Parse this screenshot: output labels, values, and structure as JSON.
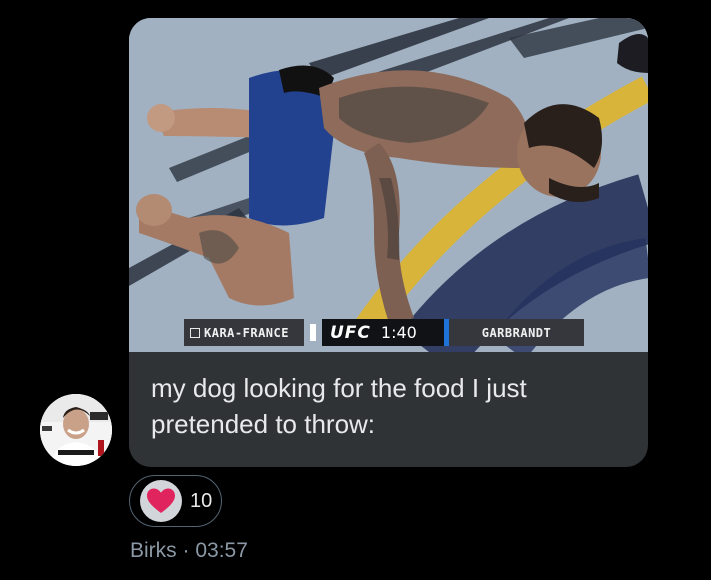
{
  "message": {
    "scoreboard": {
      "fighter_left": "KARA-FRANCE",
      "brand": "UFC",
      "clock": "1:40",
      "fighter_right": "GARBRANDT"
    },
    "caption": "my dog looking for the food I just pretended to throw:",
    "media_icons": [
      "octagon-mat",
      "fighter-on-all-fours"
    ]
  },
  "reaction": {
    "icon": "heart-icon",
    "count": "10",
    "color": "#e0245e"
  },
  "meta": {
    "sender": "Birks",
    "separator": " · ",
    "time": "03:57"
  },
  "colors": {
    "background": "#000000",
    "bubble": "#2f3336",
    "text": "#e7e9ea",
    "muted": "#8b98a5",
    "accent": "#1f73d8"
  }
}
